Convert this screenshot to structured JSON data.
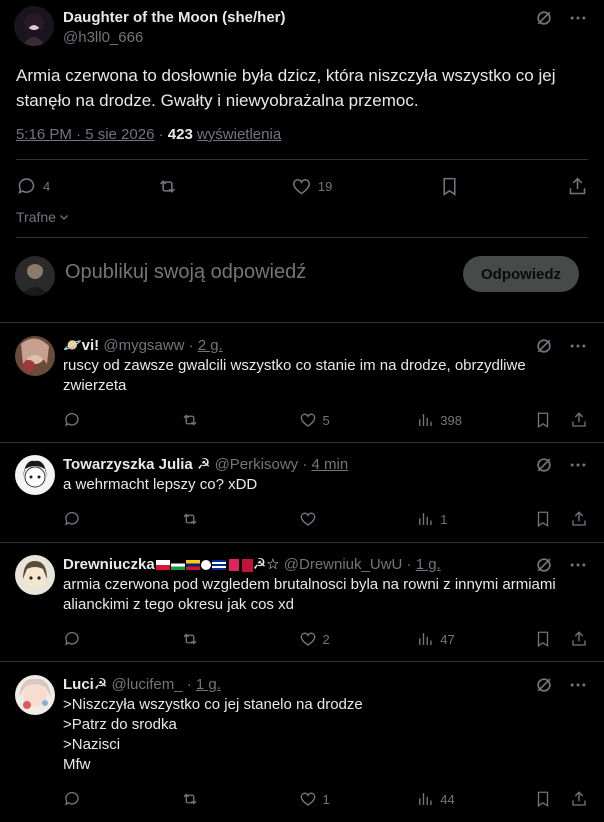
{
  "main_post": {
    "author_name": "Daughter of the Moon (she/her)",
    "author_handle": "@h3ll0_666",
    "text": "Armia czerwona to dosłownie była dzicz, która niszczyła wszystko co jej stanęło na drodze. Gwałty i niewyobrażalna przemoc.",
    "date": "5:16 PM · 5 sie 2026",
    "sep": " · ",
    "views_count": "423",
    "views_label": "wyświetlenia",
    "replies": "4",
    "reposts": "",
    "likes": "19"
  },
  "sort_label": "Trafne",
  "composer": {
    "placeholder": "Opublikuj swoją odpowiedź",
    "button": "Odpowiedz"
  },
  "replies": [
    {
      "name": "🪐vi!",
      "handle": "@mygsaww",
      "sep": "·",
      "time": "2 g.",
      "text": "ruscy od zawsze gwalcili wszystko co stanie im na drodze, obrzydliwe zwierzeta",
      "replies": "",
      "reposts": "",
      "likes": "5",
      "views": "398",
      "avatar_color": "#c9a98a"
    },
    {
      "name": "Towarzyszka Julia ☭",
      "handle": "@Perkisowy",
      "sep": "·",
      "time": "4 min",
      "text": "a wehrmacht lepszy co? xDD",
      "replies": "",
      "reposts": "",
      "likes": "",
      "views": "1",
      "avatar_color": "#e8e8e8"
    },
    {
      "name": "Drewniuczka",
      "name_suffix": "☭☆",
      "handle": "@Drewniuk_UwU",
      "sep": "·",
      "time": "1 g.",
      "text": "armia czerwona pod wzgledem brutalnosci byla na rowni z innymi armiami alianckimi z tego okresu jak cos xd",
      "replies": "",
      "reposts": "",
      "likes": "2",
      "views": "47",
      "avatar_color": "#d8d8d0"
    },
    {
      "name": "Luci☭",
      "handle": "@lucifem_",
      "sep": "·",
      "time": "1 g.",
      "lines": [
        ">Niszczyła wszystko co jej stanelo na drodze",
        ">Patrz do srodka",
        ">Nazisci",
        "Mfw"
      ],
      "replies": "",
      "reposts": "",
      "likes": "1",
      "views": "44",
      "avatar_color": "#e0d8d0"
    }
  ],
  "colors": {
    "background": "#000000",
    "text": "#e7e9ea",
    "muted": "#71767b",
    "border": "#2f3336"
  }
}
